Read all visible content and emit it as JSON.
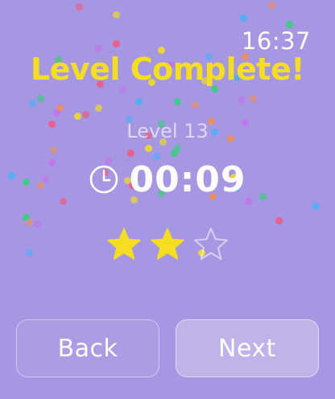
{
  "status_bar": {
    "time": "16:37"
  },
  "result": {
    "title": "Level Complete!",
    "level": "Level 13",
    "time_elapsed": "00:09",
    "stars_earned": 2,
    "stars_total": 3
  },
  "actions": {
    "back_label": "Back",
    "next_label": "Next"
  },
  "icons": {
    "timer": "stopwatch-icon",
    "star_filled": "star-filled-icon",
    "star_empty": "star-empty-icon"
  },
  "colors": {
    "background": "#a597e2",
    "title": "#f5dd21",
    "star_filled": "#f5dd21",
    "confetti": [
      "#ff4d6d",
      "#f5dd21",
      "#3fb3ff",
      "#33d17a",
      "#ff8c42",
      "#c471ed"
    ]
  }
}
